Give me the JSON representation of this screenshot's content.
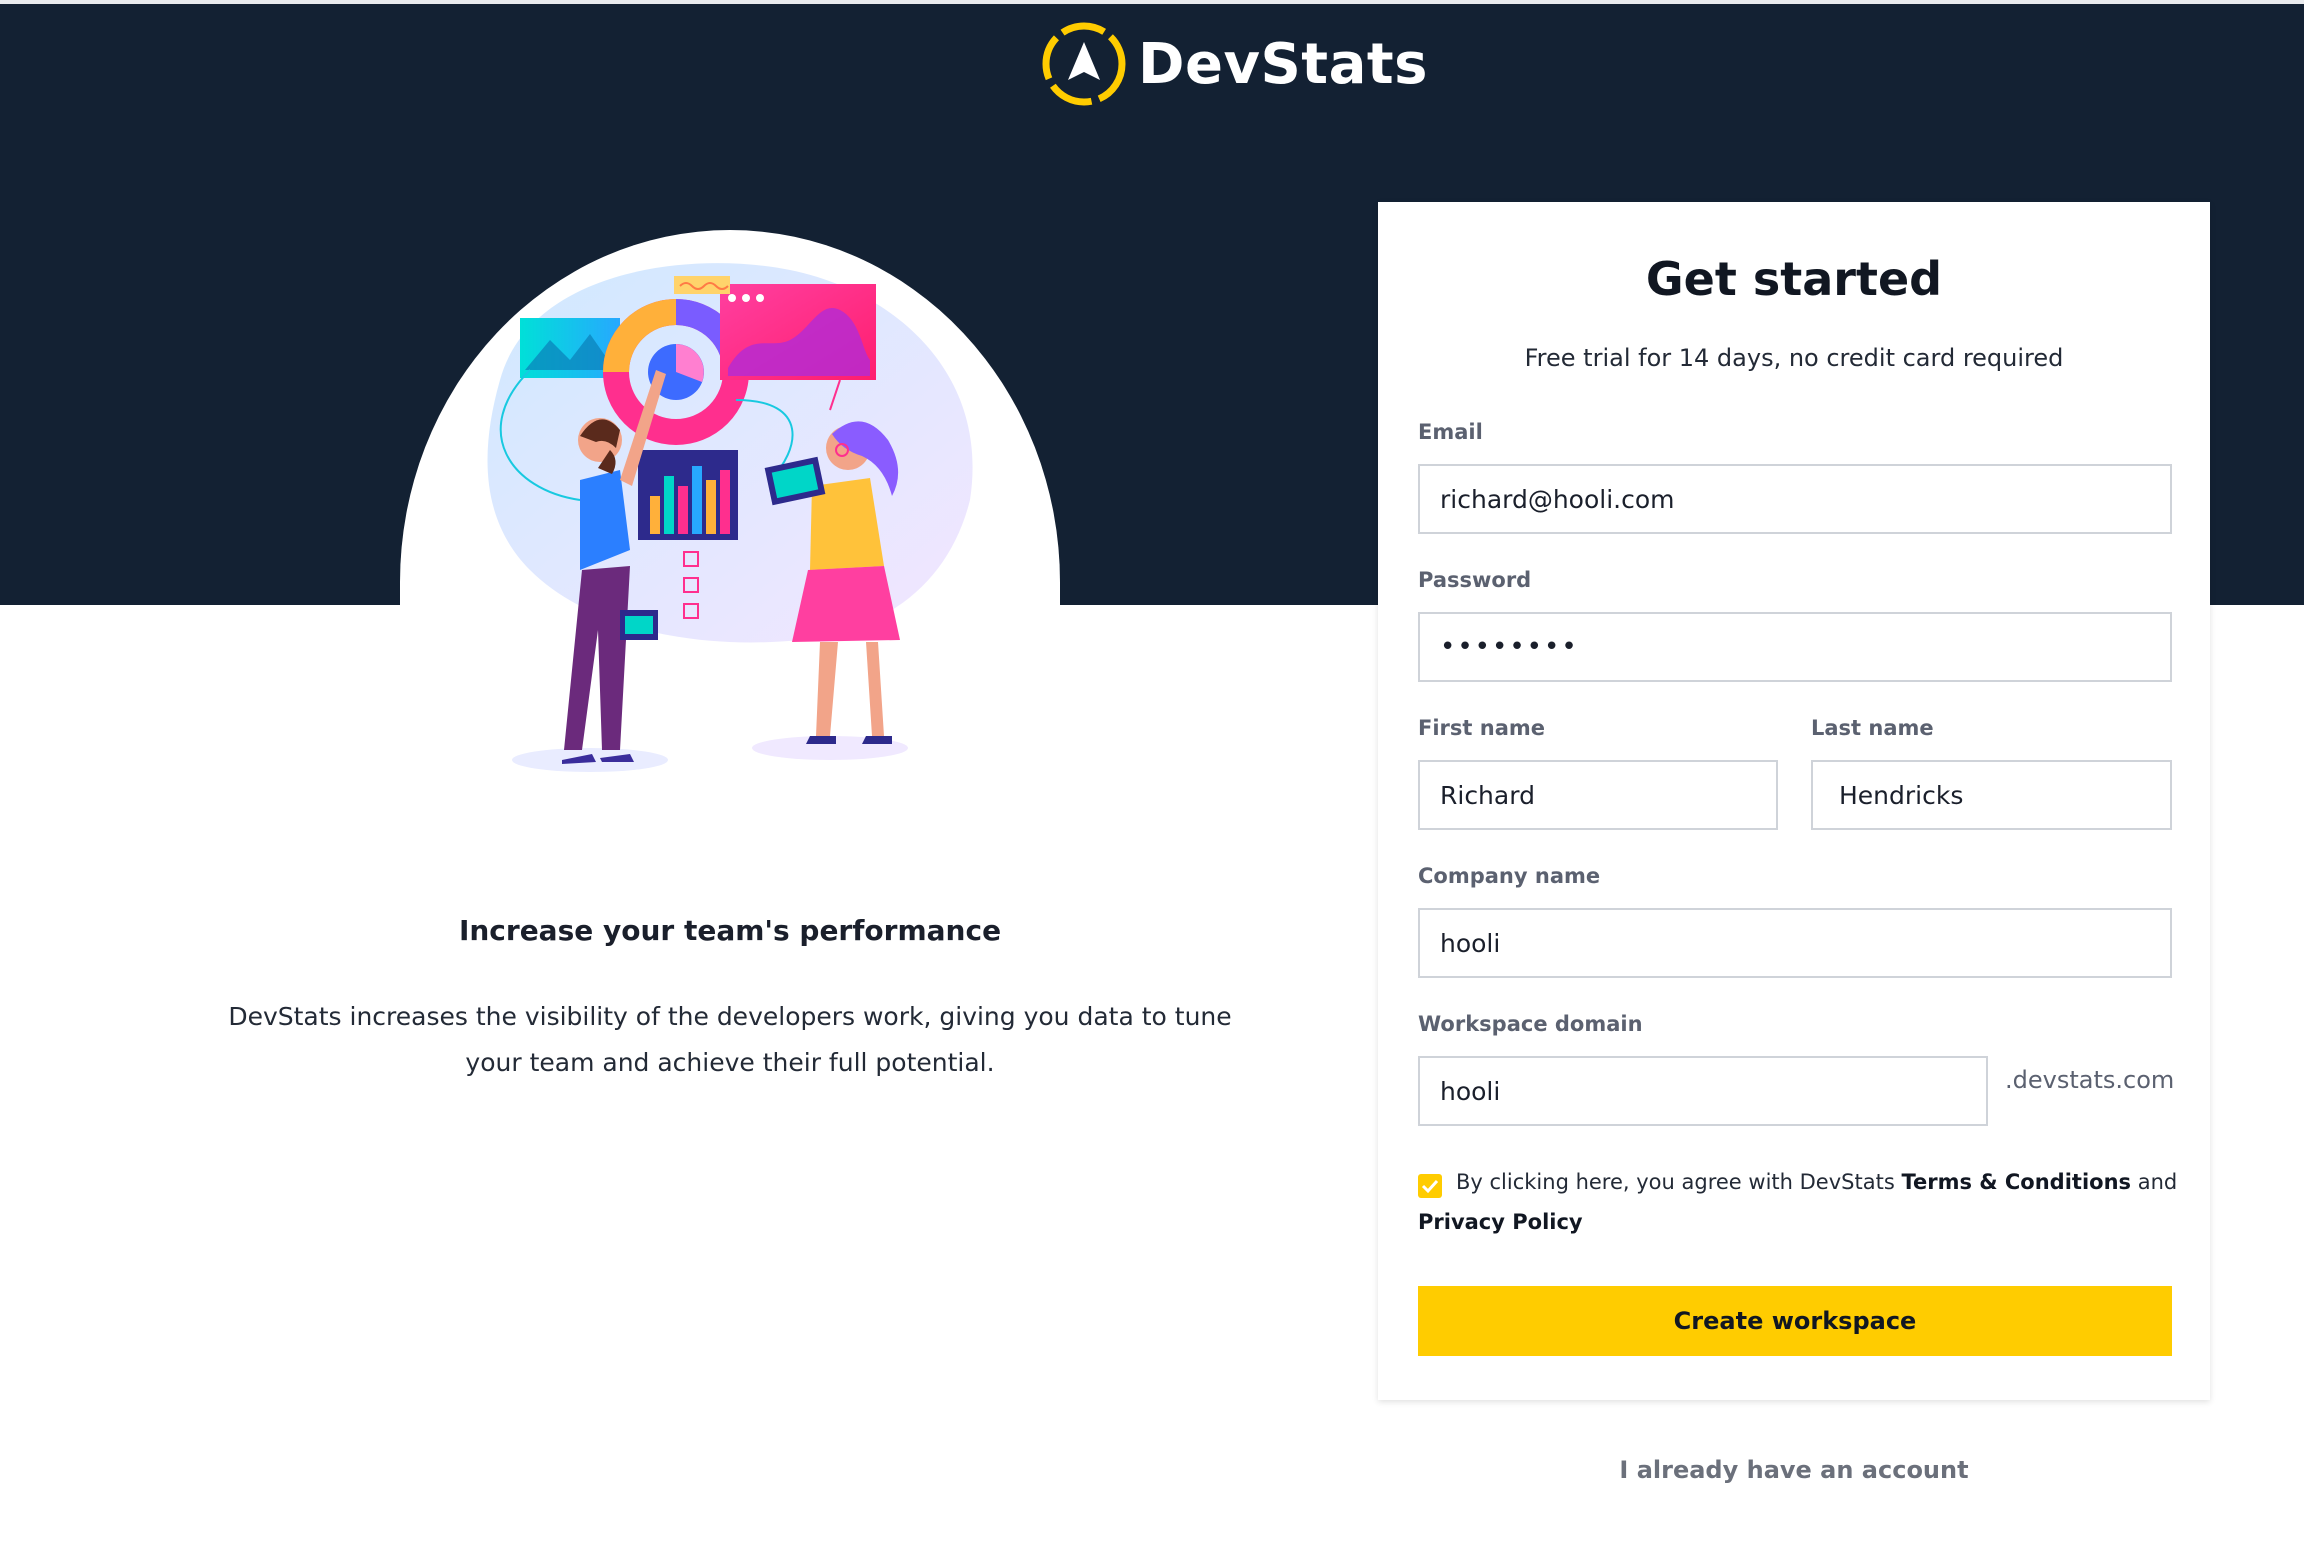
{
  "brand": {
    "name": "DevStats",
    "accent_color": "#ffcc00",
    "header_color": "#132133"
  },
  "promo": {
    "title": "Increase your team's performance",
    "text": "DevStats increases the visibility of the developers work, giving you data to tune your team and achieve their full potential.",
    "illustration_icon": "analytics-team-illustration"
  },
  "form": {
    "title": "Get started",
    "subtitle": "Free trial for 14 days, no credit card required",
    "email": {
      "label": "Email",
      "value": "richard@hooli.com"
    },
    "password": {
      "label": "Password",
      "value": "••••••••"
    },
    "first_name": {
      "label": "First name",
      "value": "Richard"
    },
    "last_name": {
      "label": "Last name",
      "value": "Hendricks"
    },
    "company": {
      "label": "Company name",
      "value": "hooli"
    },
    "workspace": {
      "label": "Workspace domain",
      "value": "hooli",
      "suffix": ".devstats.com"
    },
    "terms": {
      "checked": true,
      "prefix": "By clicking here, you agree with DevStats ",
      "terms_link": "Terms & Conditions",
      "conjunction": " and",
      "privacy_link": "Privacy Policy"
    },
    "submit_label": "Create workspace"
  },
  "signin_label": "I already have an account"
}
